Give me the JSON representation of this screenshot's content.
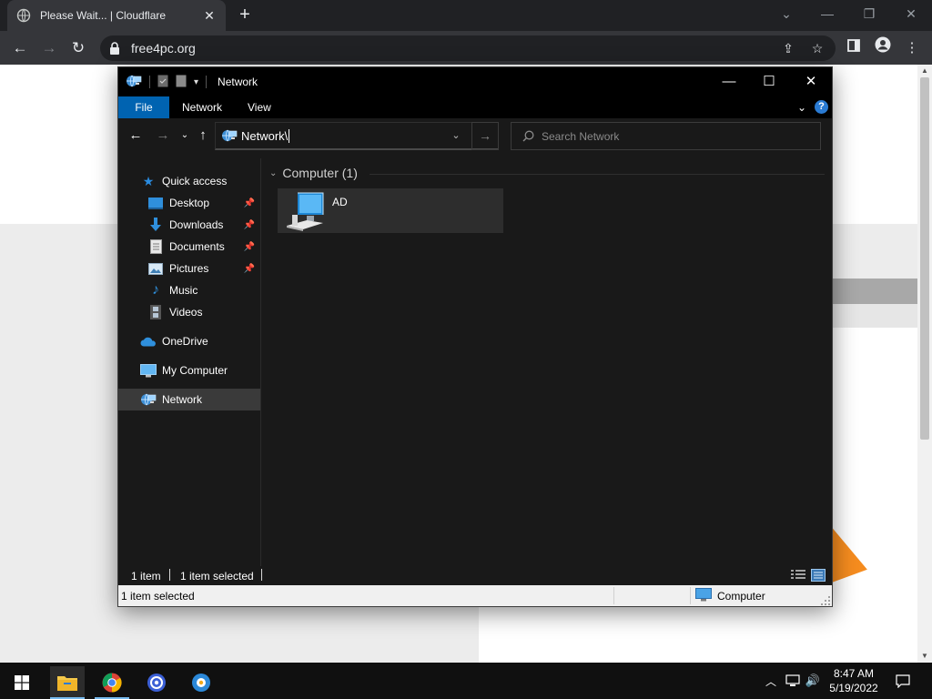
{
  "browser": {
    "tab_title": "Please Wait... | Cloudflare",
    "url": "free4pc.org"
  },
  "explorer": {
    "title": "Network",
    "ribbon_tabs": [
      "File",
      "Network",
      "View"
    ],
    "address": "Network\\",
    "search_placeholder": "Search Network",
    "nav": {
      "quick_access": "Quick access",
      "desktop": "Desktop",
      "downloads": "Downloads",
      "documents": "Documents",
      "pictures": "Pictures",
      "music": "Music",
      "videos": "Videos",
      "onedrive": "OneDrive",
      "my_computer": "My Computer",
      "network": "Network"
    },
    "group_header": "Computer (1)",
    "items": [
      {
        "name": "AD",
        "icon": "computer-icon"
      }
    ],
    "status": {
      "count": "1 item",
      "selected": "1 item selected",
      "bottom_selected": "1 item selected",
      "bottom_location": "Computer"
    }
  },
  "taskbar": {
    "time": "8:47 AM",
    "date": "5/19/2022"
  },
  "colors": {
    "accent": "#0063b1",
    "explorer_bg": "#191919",
    "taskbar": "#101010"
  }
}
